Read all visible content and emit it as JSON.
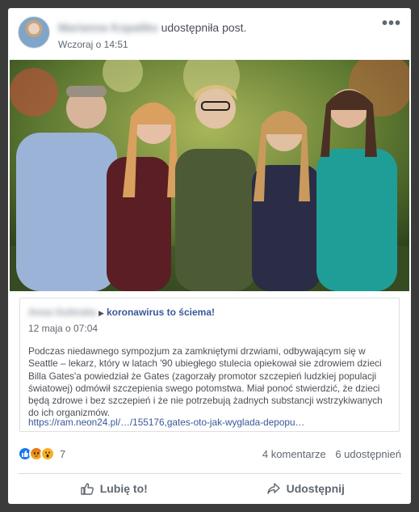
{
  "post": {
    "author_name": "Marianna Kopaliks",
    "action": " udostępniła post.",
    "timestamp": "Wczoraj o 14:51",
    "more_icon": "ellipsis-icon",
    "more_label": "•••"
  },
  "shared": {
    "author_name": "Anna Gulinska",
    "group": "koronawirus to ściema!",
    "date": "12 maja o 07:04",
    "text": "Podczas niedawnego sympozjum za zamkniętymi drzwiami, odbywającym się w Seattle – lekarz, który w latach '90 ubiegłego stulecia opiekował sie zdrowiem dzieci Billa Gates'a powiedział że Gates (zagorzały promotor szczepień ludzkiej populacji światowej) odmówił szczepienia swego potomstwa. Miał ponoć stwierdzić, że dzieci będą zdrowe i bez szczepień i że nie potrzebują żadnych substancji wstrzykiwanych do ich organizmów.",
    "link": "https://ram.neon24.pl/…/155176,gates-oto-jak-wyglada-depopu…"
  },
  "stats": {
    "reaction_count": "7",
    "comments": "4 komentarze",
    "shares": "6 udostępnień",
    "reactions": [
      "like-reaction-icon",
      "angry-reaction-icon",
      "wow-reaction-icon"
    ]
  },
  "actions": {
    "like_label": "Lubię to!",
    "share_label": "Udostępnij"
  },
  "colors": {
    "link": "#385898",
    "like_blue": "#1877f2",
    "secondary_text": "#606770"
  }
}
